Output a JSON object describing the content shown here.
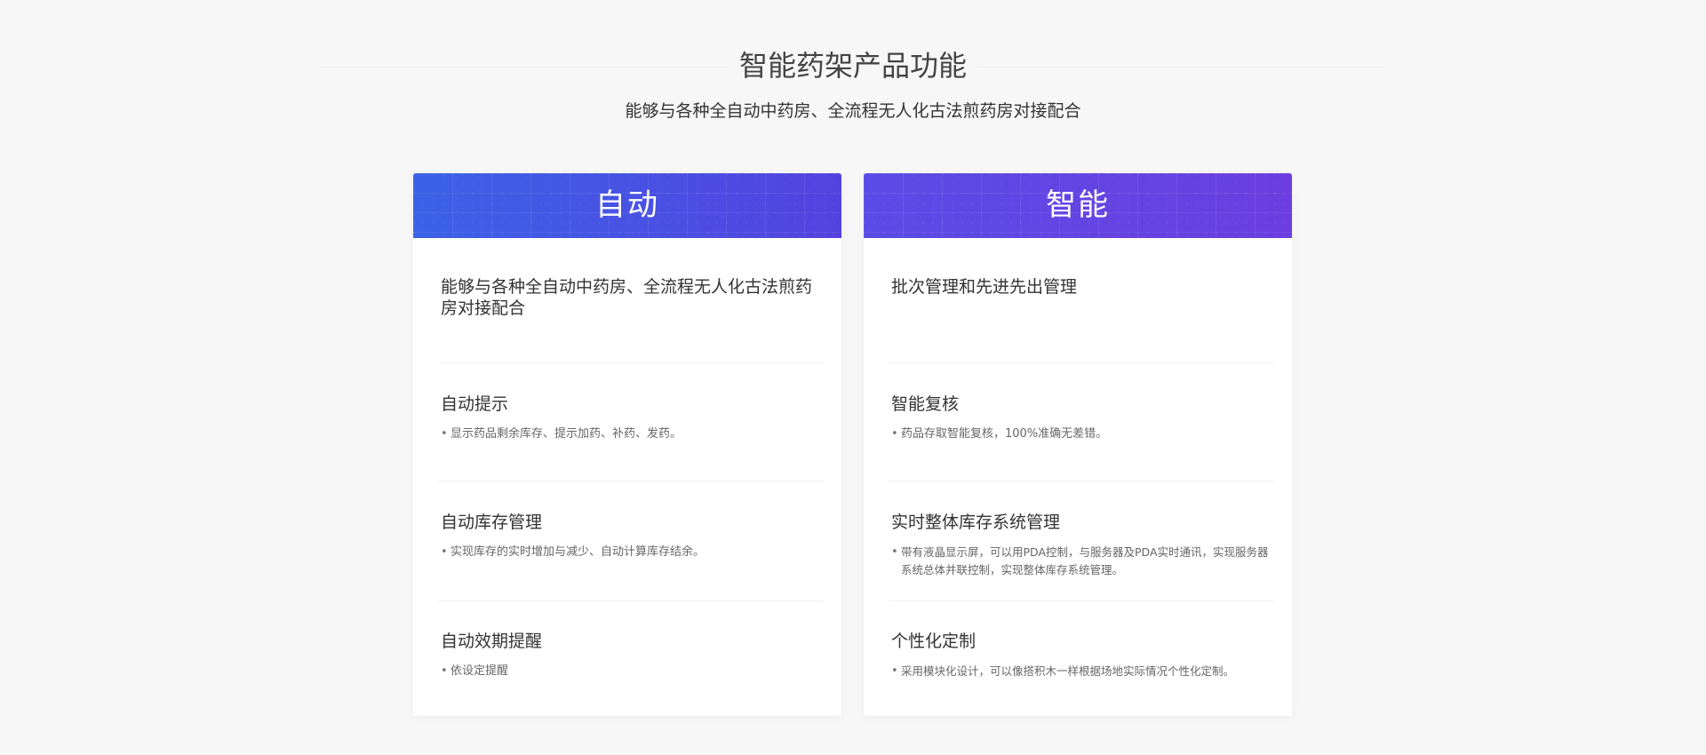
{
  "header": {
    "title": "智能药架产品功能",
    "subtitle": "能够与各种全自动中药房、全流程无人化古法煎药房对接配合"
  },
  "theme": {
    "left_gradient_start": "#3b62e6",
    "left_gradient_end": "#5442e0",
    "right_gradient_start": "#5a4be6",
    "right_gradient_end": "#6a3ee0"
  },
  "cards": [
    {
      "title": "自动",
      "intro": "能够与各种全自动中药房、全流程无人化古法煎药房对接配合",
      "features": [
        {
          "title": "自动提示",
          "bullet": "•",
          "desc": "显示药品剩余库存、提示加药、补药、发药。"
        },
        {
          "title": "自动库存管理",
          "bullet": "•",
          "desc": "实现库存的实时增加与减少、自动计算库存结余。"
        },
        {
          "title": "自动效期提醒",
          "bullet": "•",
          "desc": "依设定提醒"
        }
      ]
    },
    {
      "title": "智能",
      "intro": "批次管理和先进先出管理",
      "features": [
        {
          "title": "智能复核",
          "bullet": "•",
          "desc": "药品存取智能复核，100%准确无差错。"
        },
        {
          "title": "实时整体库存系统管理",
          "bullet": "•",
          "desc": "带有液晶显示屏，可以用PDA控制，与服务器及PDA实时通讯，实现服务器系统总体并联控制，实现整体库存系统管理。"
        },
        {
          "title": "个性化定制",
          "bullet": "•",
          "desc": "采用模块化设计，可以像搭积木一样根据场地实际情况个性化定制。"
        }
      ]
    }
  ]
}
